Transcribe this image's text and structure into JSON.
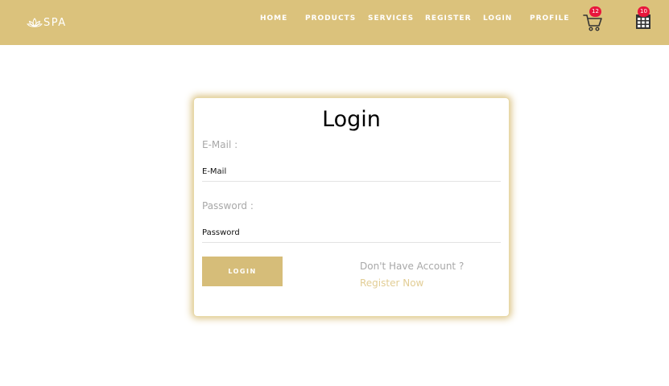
{
  "brand": {
    "name": "SPA",
    "icon": "lotus-icon"
  },
  "nav": {
    "items": [
      {
        "label": "HOME"
      },
      {
        "label": "PRODUCTS"
      },
      {
        "label": "SERVICES"
      },
      {
        "label": "REGISTER"
      },
      {
        "label": "LOGIN"
      },
      {
        "label": "PROFILE"
      }
    ],
    "cart": {
      "icon": "cart-icon",
      "badge": "12"
    },
    "calendar": {
      "icon": "calendar-icon",
      "badge": "10"
    }
  },
  "login": {
    "title": "Login",
    "email": {
      "label": "E-Mail :",
      "placeholder": "E-Mail",
      "value": ""
    },
    "password": {
      "label": "Password :",
      "placeholder": "Password",
      "value": ""
    },
    "submit_label": "LOGIN",
    "register_prompt": "Don't Have Account ? ",
    "register_link": "Register Now"
  },
  "colors": {
    "navbar": "#dbc27c",
    "button": "#d6bd79",
    "badge": "#e8163c",
    "link": "#e2cd95",
    "label": "#a8a8a8"
  }
}
